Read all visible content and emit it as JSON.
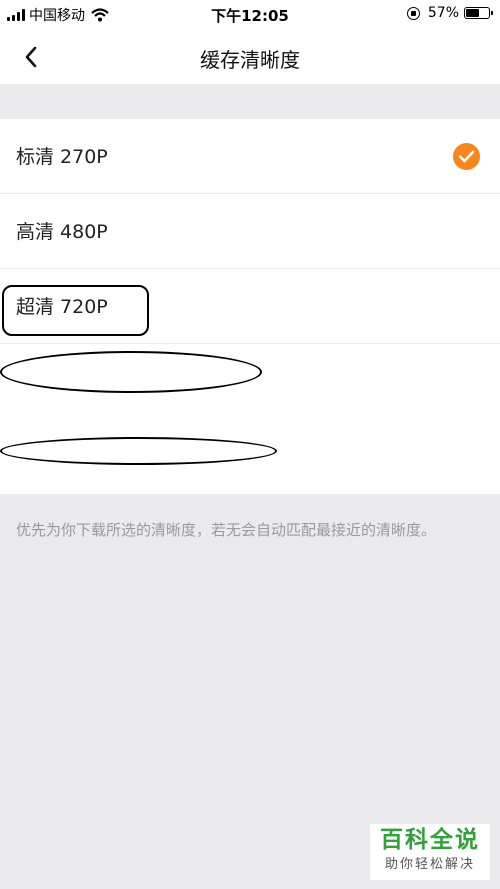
{
  "status_bar": {
    "carrier": "中国移动",
    "time": "下午12:05",
    "battery_percent_text": "57%",
    "battery_level": 0.57
  },
  "nav": {
    "title": "缓存清晰度"
  },
  "options": [
    {
      "label": "标清 270P",
      "selected": true
    },
    {
      "label": "高清 480P",
      "selected": false
    },
    {
      "label": "超清 720P",
      "selected": false
    }
  ],
  "hint": "优先为你下载所选的清晰度，若无会自动匹配最接近的清晰度。",
  "watermark": {
    "title": "百科全说",
    "subtitle": "助你轻松解决"
  },
  "colors": {
    "accent": "#f7861d",
    "background": "#ebebed",
    "watermark_green": "#2fa33a"
  }
}
